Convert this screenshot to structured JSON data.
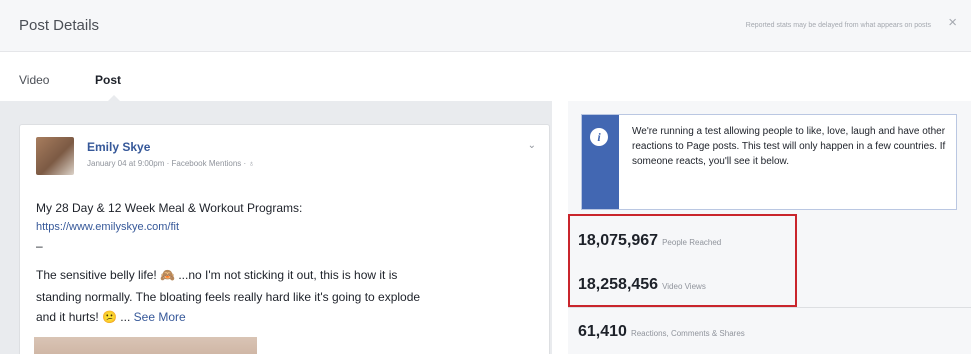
{
  "header": {
    "title": "Post Details",
    "notice": "Reported stats may be delayed from what appears on posts",
    "close_glyph": "×"
  },
  "tabs": [
    {
      "label": "Video"
    },
    {
      "label": "Post",
      "active": true
    }
  ],
  "post": {
    "author": "Emily Skye",
    "meta": "January 04 at 9:00pm · Facebook Mentions · ♁",
    "line1": "My 28 Day & 12 Week Meal & Workout Programs:",
    "link": "https://www.emilyskye.com/fit",
    "dash": "–",
    "line3": "The sensitive belly life! 🙈 ...no I'm not sticking it out, this is how it is",
    "line4": "standing normally. The bloating feels really hard like it's going to explode",
    "line5_text": "and it hurts! 😕 ... ",
    "see_more": "See More"
  },
  "info": {
    "icon_glyph": "i",
    "text": "We're running a test allowing people to like, love, laugh and have other reactions to Page posts. This test will only happen in a few countries. If someone reacts, you'll see it below."
  },
  "stats": {
    "people_reached": {
      "value": "18,075,967",
      "label": "People Reached"
    },
    "video_views": {
      "value": "18,258,456",
      "label": "Video Views"
    },
    "reactions": {
      "value": "61,410",
      "label": "Reactions, Comments & Shares"
    }
  },
  "colors": {
    "accent_blue": "#4267b2",
    "link_blue": "#365899",
    "highlight_red": "#c9252c"
  }
}
